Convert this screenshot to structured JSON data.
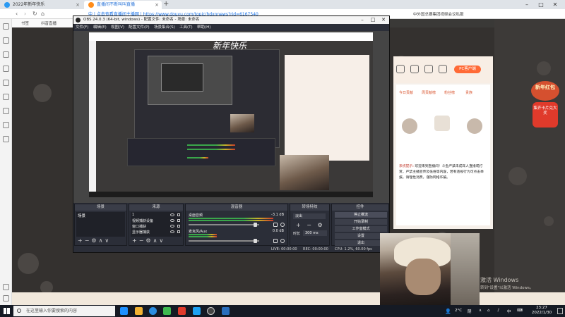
{
  "browser": {
    "tabs": [
      {
        "label": "2022年新年快乐",
        "active": false
      },
      {
        "label": "直播间不断叫叫直播",
        "active": true
      }
    ],
    "new_tab_symbol": "+",
    "url": "中 | 点击查看直播间主播网 | https://www.douyu.com/topic/hdxnnews?rid=6167540",
    "address_right": "中外国总要集团视频会议私服",
    "bookmarks": [
      "书签",
      "抖音直播"
    ],
    "window_controls": [
      "–",
      "□",
      "✕"
    ]
  },
  "obs": {
    "title": "OBS 24.0.3 (64-bit, windows) - 配置文件: 未命名 - 场景: 未命名",
    "menu": [
      "文件(F)",
      "编辑(E)",
      "视图(V)",
      "配置文件(P)",
      "场景集合(S)",
      "工具(T)",
      "帮助(H)"
    ],
    "preview": {
      "headline": "新年快乐"
    },
    "docks": {
      "scenes": {
        "title": "场景",
        "items": [
          "场景"
        ]
      },
      "sources": {
        "title": "来源",
        "items": [
          "1",
          "视频捕获设备",
          "窗口捕获",
          "显示器捕获"
        ]
      },
      "mixer": {
        "title": "混音器",
        "channels": [
          {
            "name": "桌面音频",
            "db": "-3.1 dB"
          },
          {
            "name": "麦克风/Aux",
            "db": "0.0 dB"
          }
        ]
      },
      "transitions": {
        "title": "转场特效",
        "selected": "淡出",
        "duration_label": "时长",
        "duration_value": "300 ms"
      },
      "controls": {
        "title": "控件",
        "buttons": [
          "停止推流",
          "开始录制",
          "工作室模式",
          "设置",
          "退出"
        ]
      }
    },
    "footer_icons": "+−⚙∧∨",
    "status": {
      "live": "LIVE: 00:00:00",
      "rec": "REC: 00:00:00",
      "cpu": "CPU: 1.2%, 60.00 fps"
    }
  },
  "chat": {
    "pc_button": "PC客户端",
    "tabs": [
      "今日贡献",
      "周贡献榜",
      "粉丝榜",
      "贵族"
    ],
    "system_label": "系统提示:",
    "message": "欢迎来到直播间！斗鱼严禁未成年人直播或打赏，严禁主播宣传及低俗等内容，若有违规行为可点击举报。请理性消费，谨防网络诈骗。"
  },
  "badge": {
    "top": "新年红包",
    "bottom": "集齐卡片兑大奖"
  },
  "watermark": {
    "line1": "激活 Windows",
    "line2": "转到\"设置\"以激活 Windows。"
  },
  "taskbar": {
    "search_placeholder": "在这里输入你要搜索的内容",
    "temperature": "2°C",
    "weather": "阴",
    "ime": "中",
    "time": "23:27",
    "date": "2022/1/30"
  },
  "colors": {
    "accent_orange": "#ff6a36",
    "obs_bg": "#2b2e38",
    "page_bg": "#34312f"
  }
}
